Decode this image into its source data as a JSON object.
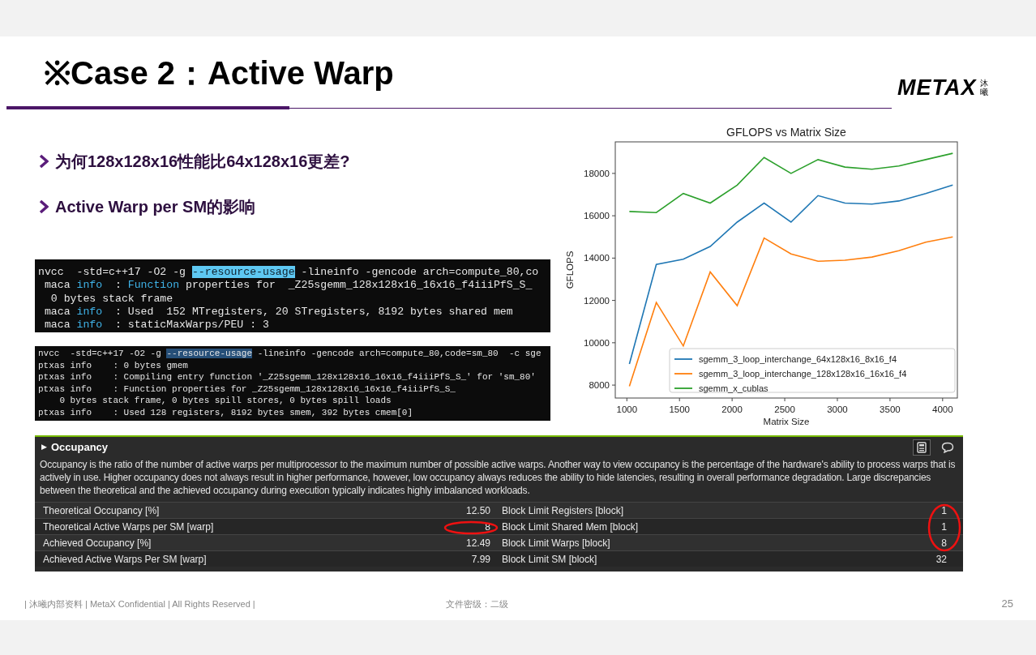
{
  "slide": {
    "title": "※Case 2：Active Warp",
    "logo": {
      "text": "METAX",
      "subtext": "沐曦"
    },
    "bullets": [
      "为何128x128x16性能比64x128x16更差?",
      "Active Warp per SM的影响"
    ],
    "terminals": [
      {
        "lines": [
          [
            {
              "kind": "plain",
              "text": "nvcc  -std=c++17 -O2 -g "
            },
            {
              "kind": "selected",
              "text": "--resource-usage"
            },
            {
              "kind": "plain",
              "text": " -lineinfo -gencode arch=compute_80,co"
            }
          ],
          [
            {
              "kind": "plain",
              "text": " maca "
            },
            {
              "kind": "keyword",
              "text": "info"
            },
            {
              "kind": "plain",
              "text": "  : "
            },
            {
              "kind": "keyword",
              "text": "Function"
            },
            {
              "kind": "plain",
              "text": " properties for  _Z25sgemm_128x128x16_16x16_f4iiiPfS_S_"
            }
          ],
          [
            {
              "kind": "plain",
              "text": "  0 bytes stack frame"
            }
          ],
          [
            {
              "kind": "plain",
              "text": " maca "
            },
            {
              "kind": "keyword",
              "text": "info"
            },
            {
              "kind": "plain",
              "text": "  : Used  152 MTregisters, 20 STregisters, 8192 bytes shared mem"
            }
          ],
          [
            {
              "kind": "plain",
              "text": " maca "
            },
            {
              "kind": "keyword",
              "text": "info"
            },
            {
              "kind": "plain",
              "text": "  : staticMaxWarps/PEU : 3"
            }
          ]
        ]
      },
      {
        "lines": [
          [
            {
              "kind": "plain",
              "text": "nvcc  -std=c++17 -O2 -g "
            },
            {
              "kind": "highlight",
              "text": "--resource-usage"
            },
            {
              "kind": "plain",
              "text": " -lineinfo -gencode arch=compute_80,code=sm_80  -c sge"
            }
          ],
          [
            {
              "kind": "plain",
              "text": "ptxas info    : 0 bytes gmem"
            }
          ],
          [
            {
              "kind": "plain",
              "text": "ptxas info    : Compiling entry function '_Z25sgemm_128x128x16_16x16_f4iiiPfS_S_' for 'sm_80'"
            }
          ],
          [
            {
              "kind": "plain",
              "text": "ptxas info    : Function properties for _Z25sgemm_128x128x16_16x16_f4iiiPfS_S_"
            }
          ],
          [
            {
              "kind": "plain",
              "text": "    0 bytes stack frame, 0 bytes spill stores, 0 bytes spill loads"
            }
          ],
          [
            {
              "kind": "plain",
              "text": "ptxas info    : Used 128 registers, 8192 bytes smem, 392 bytes cmem[0]"
            }
          ]
        ]
      }
    ],
    "chart": {
      "chart_data": {
        "type": "line",
        "title": "GFLOPS vs Matrix Size",
        "xlabel": "Matrix Size",
        "ylabel": "GFLOPS",
        "x": [
          1024,
          1280,
          1536,
          1792,
          2048,
          2304,
          2560,
          2816,
          3072,
          3328,
          3584,
          3840,
          4096
        ],
        "series": [
          {
            "name": "sgemm_3_loop_interchange_64x128x16_8x16_f4",
            "color": "#1f77b4",
            "values": [
              9000,
              13700,
              13950,
              14550,
              15700,
              16600,
              15700,
              16950,
              16600,
              16550,
              16700,
              17050,
              17450
            ]
          },
          {
            "name": "sgemm_3_loop_interchange_128x128x16_16x16_f4",
            "color": "#ff7f0e",
            "values": [
              7950,
              11900,
              9850,
              13350,
              11750,
              14950,
              14200,
              13850,
              13900,
              14050,
              14350,
              14750,
              15000
            ]
          },
          {
            "name": "sgemm_x_cublas",
            "color": "#2ca02c",
            "values": [
              16200,
              16150,
              17050,
              16600,
              17450,
              18750,
              18000,
              18650,
              18300,
              18200,
              18350,
              18650,
              18950
            ]
          }
        ],
        "xlim": [
          890,
          4140
        ],
        "ylim": [
          7390,
          19490
        ],
        "legend": "lower right",
        "xticks": [
          1000,
          1500,
          2000,
          2500,
          3000,
          3500,
          4000
        ],
        "yticks": [
          8000,
          10000,
          12000,
          14000,
          16000,
          18000
        ]
      }
    },
    "occupancy": {
      "toggle": "▶",
      "title": "Occupancy",
      "description": "Occupancy is the ratio of the number of active warps per multiprocessor to the maximum number of possible active warps. Another way to view occupancy is the percentage of the hardware's ability to process warps that is actively in use. Higher occupancy does not always result in higher performance, however, low occupancy always reduces the ability to hide latencies, resulting in overall performance degradation. Large discrepancies between the theoretical and the achieved occupancy during execution typically indicates highly imbalanced workloads.",
      "rows": [
        {
          "label": "Theoretical Occupancy [%]",
          "value": "12.50",
          "label_2": "Block Limit Registers [block]",
          "value_2": "1"
        },
        {
          "label": "Theoretical Active Warps per SM [warp]",
          "value": "8",
          "label_2": "Block Limit Shared Mem [block]",
          "value_2": "1"
        },
        {
          "label": "Achieved Occupancy [%]",
          "value": "12.49",
          "label_2": "Block Limit Warps [block]",
          "value_2": "8"
        },
        {
          "label": "Achieved Active Warps Per SM [warp]",
          "value": "7.99",
          "label_2": "Block Limit SM [block]",
          "value_2": "32"
        }
      ]
    },
    "footer": {
      "left": "| 沐曦内部资料 | MetaX Confidential | All Rights Reserved |",
      "center": "文件密级：二级",
      "page": "25"
    }
  }
}
